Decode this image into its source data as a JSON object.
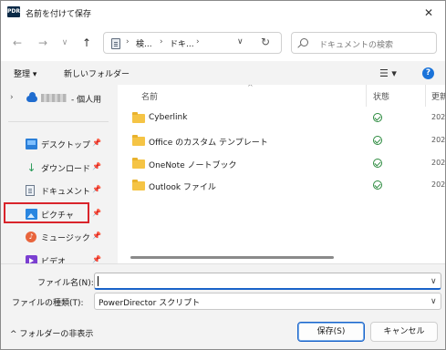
{
  "window": {
    "title": "名前を付けて保存",
    "app_icon_text": "PDR",
    "close_glyph": "✕"
  },
  "nav": {
    "back": "←",
    "forward": "→",
    "recent": "∨",
    "up": "↑",
    "breadcrumbs": [
      "検...",
      "ドキ..."
    ],
    "crumb_sep": "›",
    "refresh": "↻",
    "search_placeholder": "ドキュメントの検索"
  },
  "toolbar": {
    "organize": "整理 ▾",
    "new_folder": "新しいフォルダー",
    "view": "☰ ▾",
    "help": "?"
  },
  "sidebar": {
    "cloud": {
      "label": "- 個人用",
      "expand": "›"
    },
    "items": [
      {
        "label": "デスクトップ",
        "icon": "desktop-icon"
      },
      {
        "label": "ダウンロード",
        "icon": "download-icon"
      },
      {
        "label": "ドキュメント",
        "icon": "document-icon"
      },
      {
        "label": "ピクチャ",
        "icon": "picture-icon"
      },
      {
        "label": "ミュージック",
        "icon": "music-icon"
      },
      {
        "label": "ビデオ",
        "icon": "video-icon"
      }
    ],
    "pin": "📌",
    "highlight_color": "#d9242b"
  },
  "main": {
    "columns": {
      "name": "名前",
      "status": "状態",
      "modified": "更新"
    },
    "files": [
      {
        "name": "Cyberlink",
        "date": "202"
      },
      {
        "name": "Office のカスタム テンプレート",
        "date": "202"
      },
      {
        "name": "OneNote ノートブック",
        "date": "202"
      },
      {
        "name": "Outlook ファイル",
        "date": "202"
      }
    ]
  },
  "form": {
    "filename_label": "ファイル名(N):",
    "filename_value": "",
    "filetype_label": "ファイルの種類(T):",
    "filetype_value": "PowerDirector スクリプト"
  },
  "footer": {
    "hide_folders": "^ フォルダーの非表示",
    "save": "保存(S)",
    "cancel": "キャンセル"
  },
  "colors": {
    "accent": "#1a63c9",
    "folder": "#f5c445",
    "status_ok": "#2b8a3e"
  }
}
